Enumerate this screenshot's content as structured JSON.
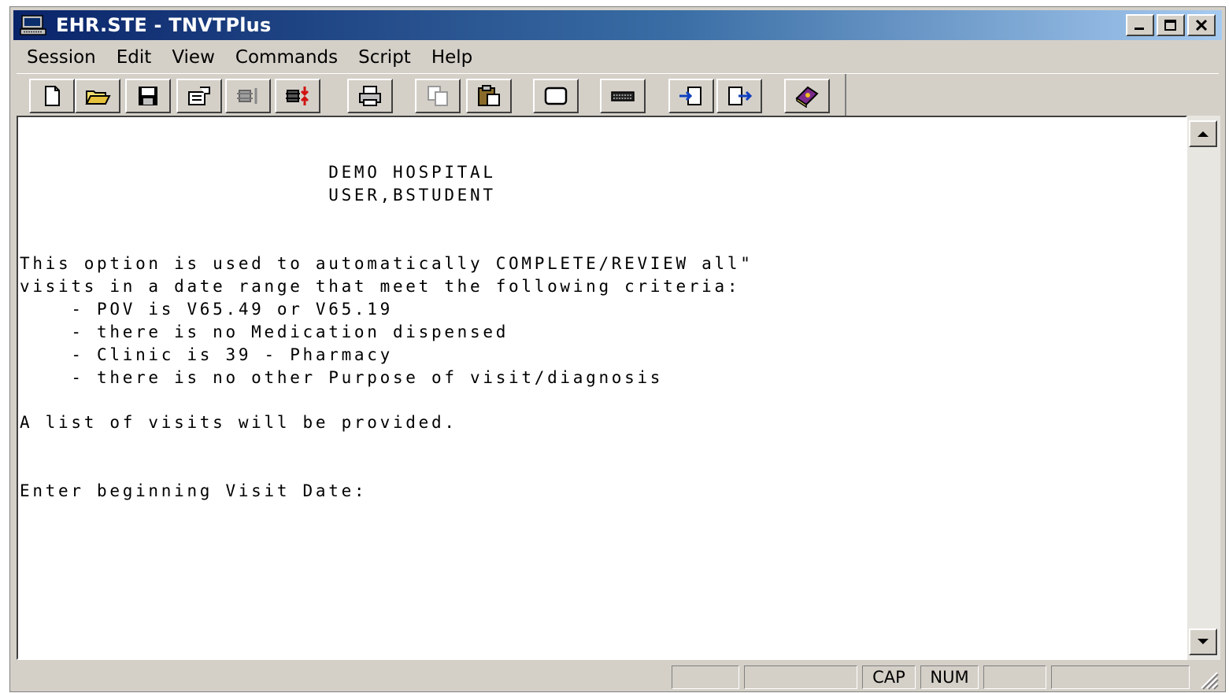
{
  "window": {
    "title": "EHR.STE - TNVTPlus"
  },
  "menu": [
    "Session",
    "Edit",
    "View",
    "Commands",
    "Script",
    "Help"
  ],
  "toolbar": [
    {
      "name": "new-icon"
    },
    {
      "name": "open-folder-icon"
    },
    {
      "name": "save-icon"
    },
    {
      "name": "properties-icon"
    },
    {
      "name": "connect-icon"
    },
    {
      "name": "disconnect-icon"
    },
    {
      "name": "print-icon"
    },
    {
      "name": "copy-icon"
    },
    {
      "name": "paste-icon"
    },
    {
      "name": "screen-icon"
    },
    {
      "name": "keyboard-icon"
    },
    {
      "name": "capture-in-icon"
    },
    {
      "name": "capture-out-icon"
    },
    {
      "name": "help-book-icon"
    }
  ],
  "terminal": {
    "lines": [
      "                        DEMO HOSPITAL",
      "                        USER,BSTUDENT",
      "",
      "",
      "This option is used to automatically COMPLETE/REVIEW all\"",
      "visits in a date range that meet the following criteria:",
      "    - POV is V65.49 or V65.19",
      "    - there is no Medication dispensed",
      "    - Clinic is 39 - Pharmacy",
      "    - there is no other Purpose of visit/diagnosis",
      "",
      "A list of visits will be provided.",
      "",
      "",
      "Enter beginning Visit Date:"
    ]
  },
  "status": {
    "cap": "CAP",
    "num": "NUM"
  },
  "colors": {
    "titlebar": "#0a246a",
    "chrome": "#d4d0c8",
    "terminal_bg": "#ffffff"
  }
}
